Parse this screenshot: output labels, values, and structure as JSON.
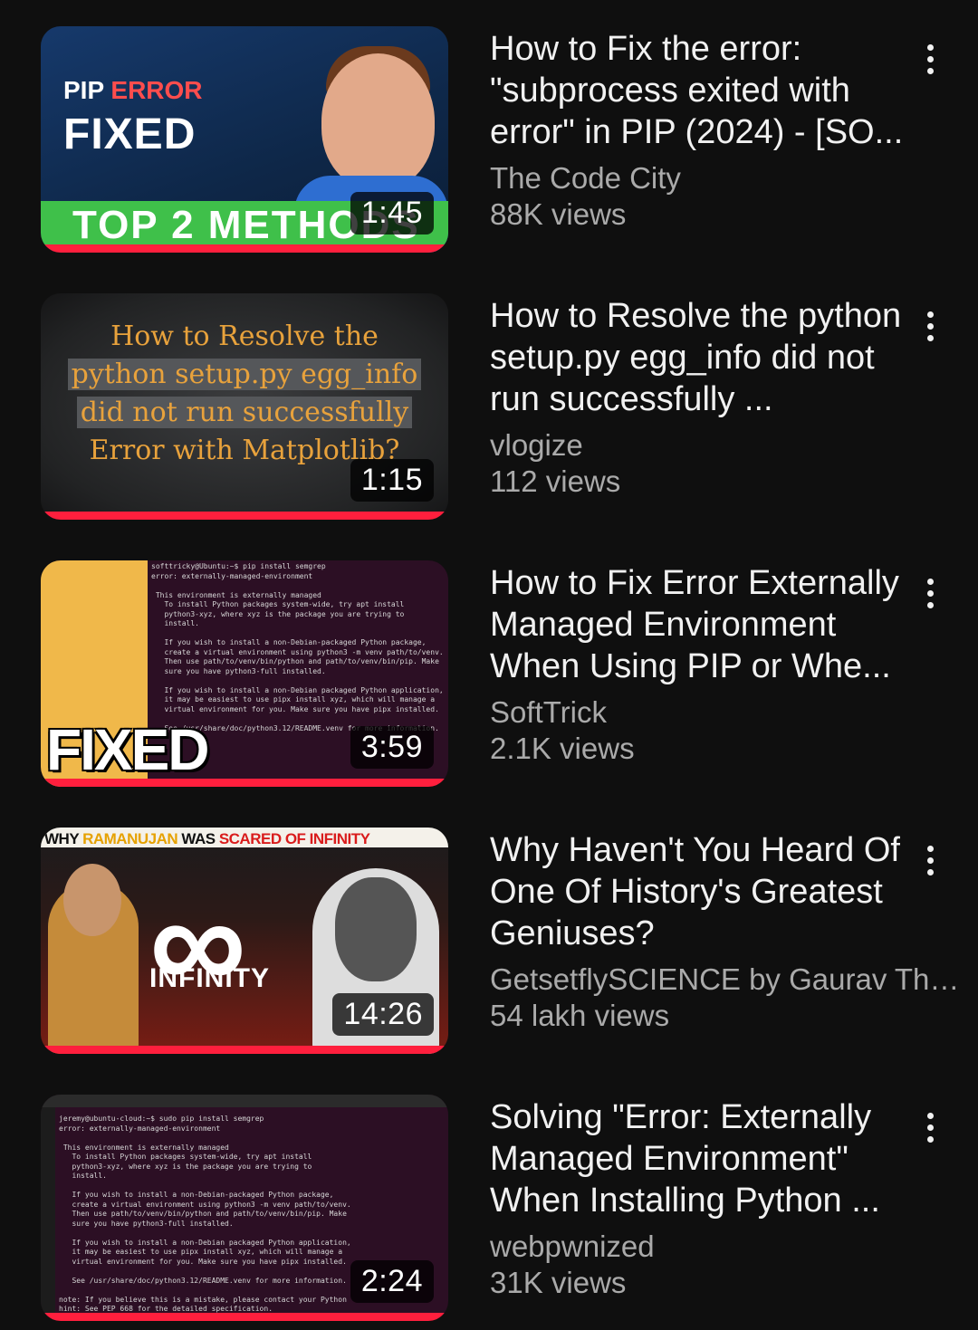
{
  "videos": [
    {
      "title": "How to Fix the error: \"subprocess exited with error\" in PIP (2024) - [SO...",
      "channel": "The Code City",
      "views": "88K views",
      "duration": "1:45",
      "thumbnail_text": {
        "line1a": "PIP",
        "line1b": "ERROR",
        "line2": "FIXED",
        "band": "TOP 2 METHODS"
      }
    },
    {
      "title": "How to Resolve the python setup.py egg_info did not run successfully ...",
      "channel": "vlogize",
      "views": "112 views",
      "duration": "1:15",
      "thumbnail_text": {
        "l1": "How to Resolve the",
        "l2": "python setup.py egg_info",
        "l3": "did not run successfully",
        "l4": "Error with Matplotlib?"
      }
    },
    {
      "title": "How to Fix Error Externally Managed Environment When Using PIP or Whe...",
      "channel": "SoftTrick",
      "views": "2.1K views",
      "duration": "3:59",
      "thumbnail_text": {
        "big": "FIXED"
      }
    },
    {
      "title": "Why Haven't You Heard Of One Of History's Greatest Geniuses?",
      "channel": "GetsetflySCIENCE by Gaurav Tha...",
      "views": "54 lakh views",
      "duration": "14:26",
      "thumbnail_text": {
        "a": "WHY ",
        "b": "RAMANUJAN",
        "c": " WAS ",
        "d": "SCARED OF INFINITY",
        "symbol": "∞",
        "word": "INFINITY"
      }
    },
    {
      "title": "Solving \"Error: Externally Managed Environment\" When Installing Python ...",
      "channel": "webpwnized",
      "views": "31K views",
      "duration": "2:24"
    }
  ],
  "colors": {
    "background": "#0f0f0f",
    "title": "#f1f1f1",
    "meta": "#aaaaaa",
    "progress": "#ff1f3d"
  },
  "icons": {
    "more": "more-vert-icon"
  }
}
